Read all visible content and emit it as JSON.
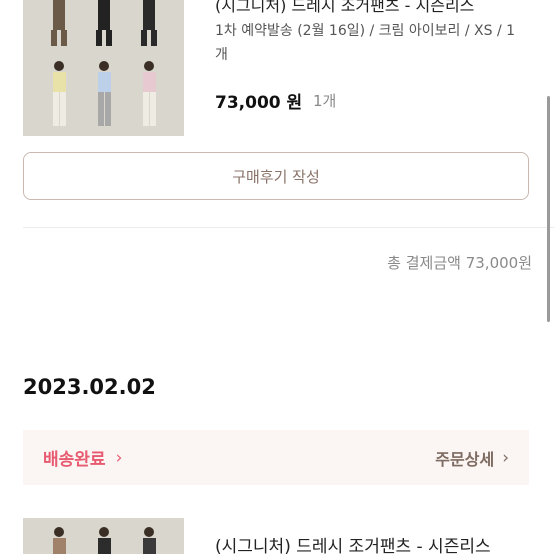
{
  "order1": {
    "product_title": "(시그니처) 드레시 조거팬츠 - 시즌리스",
    "options": "1차 예약발송 (2월 16일) / 크림 아이보리 / XS / 1개",
    "price": "73,000 원",
    "quantity": "1개",
    "review_button": "구매후기 작성",
    "total": "총 결제금액 73,000원"
  },
  "order2": {
    "date": "2023.02.02",
    "status": "배송완료",
    "detail_link": "주문상세",
    "product_title": "(시그니처) 드레시 조거팬츠 - 시즌리스"
  },
  "icons": [
    "chevron-right-icon"
  ],
  "colors": {
    "status": "#e85a70",
    "accent_brown": "#7e6b62",
    "card_bg": "#fbf6f3"
  }
}
